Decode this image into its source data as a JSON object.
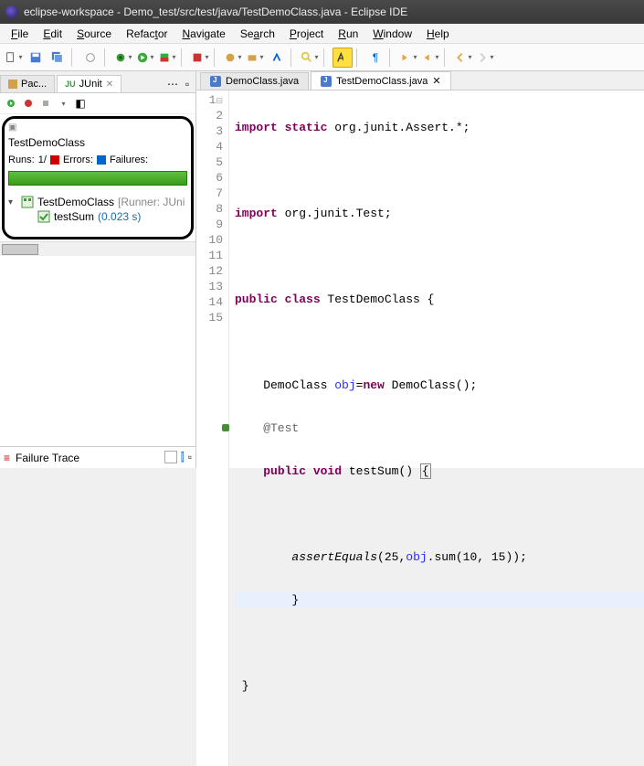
{
  "window": {
    "title": "eclipse-workspace - Demo_test/src/test/java/TestDemoClass.java - Eclipse IDE"
  },
  "menu": {
    "file": "File",
    "edit": "Edit",
    "source": "Source",
    "refactor": "Refactor",
    "navigate": "Navigate",
    "search": "Search",
    "project": "Project",
    "run": "Run",
    "window": "Window",
    "help": "Help"
  },
  "leftTabs": {
    "pac": "Pac...",
    "junit": "JUnit"
  },
  "junit": {
    "testClass": "TestDemoClass",
    "runsLabel": "Runs:",
    "runsVal": "1/",
    "errorsLabel": "Errors:",
    "failuresLabel": "Failures:",
    "tree": {
      "parent": "TestDemoClass",
      "runner": "[Runner: JUni",
      "child": "testSum",
      "childTime": "(0.023 s)"
    },
    "failureTrace": "Failure Trace"
  },
  "editorTabs": {
    "demo": "DemoClass.java",
    "testDemo": "TestDemoClass.java"
  },
  "code": {
    "l1a": "import static",
    "l1b": " org.junit.Assert.*;",
    "l3a": "import",
    "l3b": " org.junit.Test;",
    "l5a": "public class",
    "l5b": " TestDemoClass {",
    "l7a": "    DemoClass ",
    "l7b": "obj",
    "l7c": "=",
    "l7d": "new",
    "l7e": " DemoClass();",
    "l8": "    @Test",
    "l9a": "    ",
    "l9b": "public void",
    "l9c": " testSum() ",
    "l11a": "        ",
    "l11b": "assertEquals",
    "l11c": "(25,",
    "l11d": "obj",
    "l11e": ".sum(10, 15));",
    "l12": "        }",
    "l14": " }"
  },
  "lineNumbers": [
    "1",
    "2",
    "3",
    "4",
    "5",
    "6",
    "7",
    "8",
    "9",
    "10",
    "11",
    "12",
    "13",
    "14",
    "15"
  ]
}
